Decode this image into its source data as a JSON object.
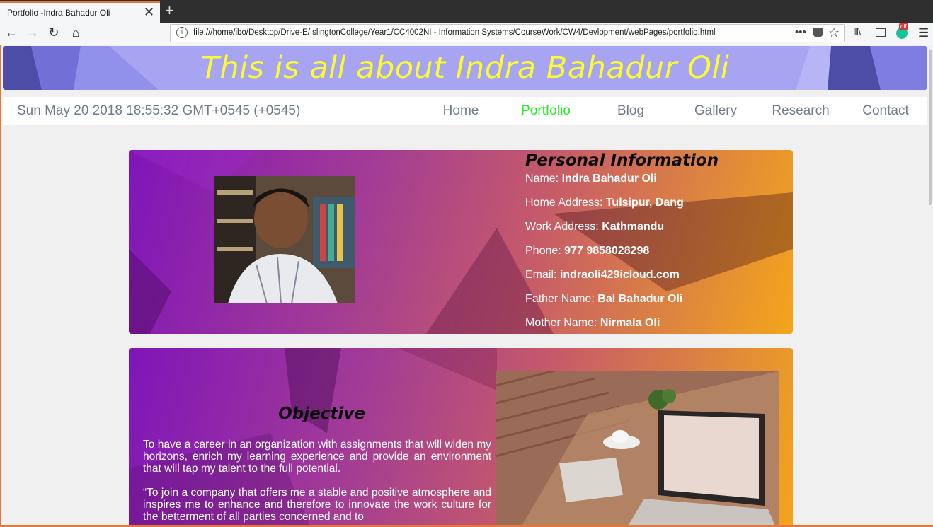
{
  "browser": {
    "tab_title": "Portfolio -Indra Bahadur Oli",
    "tab_close": "✕",
    "new_tab": "+",
    "back": "←",
    "forward": "→",
    "reload": "↻",
    "home": "⌂",
    "url_info": "i",
    "url": "file:///home/ibo/Desktop/Drive-E/IslingtonCollege/Year1/CC4002NI - Information Systems/CourseWork/CW4/Devlopment/webPages/portfolio.html",
    "page_actions": "•••",
    "bookmark_star": "☆",
    "library": "lll\\",
    "grammarly_badge": "off",
    "menu": "☰"
  },
  "banner": {
    "title": "This is all about Indra Bahadur Oli"
  },
  "nav": {
    "date": "Sun May 20 2018 18:55:32 GMT+0545 (+0545)",
    "links": [
      "Home",
      "Portfolio",
      "Blog",
      "Gallery",
      "Research",
      "Contact"
    ],
    "active": "Portfolio",
    "active_color": "#1df218"
  },
  "personal": {
    "title": "Personal Information",
    "rows": [
      {
        "label": "Name:",
        "value": "Indra Bahadur Oli"
      },
      {
        "label": "Home Address:",
        "value": "Tulsipur, Dang"
      },
      {
        "label": "Work Address:",
        "value": "Kathmandu"
      },
      {
        "label": "Phone:",
        "value": "977 9858028298"
      },
      {
        "label": "Email:",
        "value": "indraoli429icloud.com"
      },
      {
        "label": "Father Name:",
        "value": "Bal Bahadur Oli"
      },
      {
        "label": "Mother Name:",
        "value": "Nirmala Oli"
      }
    ]
  },
  "objective": {
    "title": "Objective",
    "para1": "To have a career in an organization with assignments that will widen my horizons, enrich my learning experience and provide an environment that will tap my talent to the full potential.",
    "para2": "“To join a company that offers me a stable and positive atmosphere and inspires me to enhance and therefore to innovate the work culture for the betterment of all parties concerned and to"
  },
  "colors": {
    "banner_bg": "#a7a4f2",
    "banner_text": "#fbfa33",
    "nav_text": "#6f7d8b",
    "accent": "#e8763b"
  }
}
